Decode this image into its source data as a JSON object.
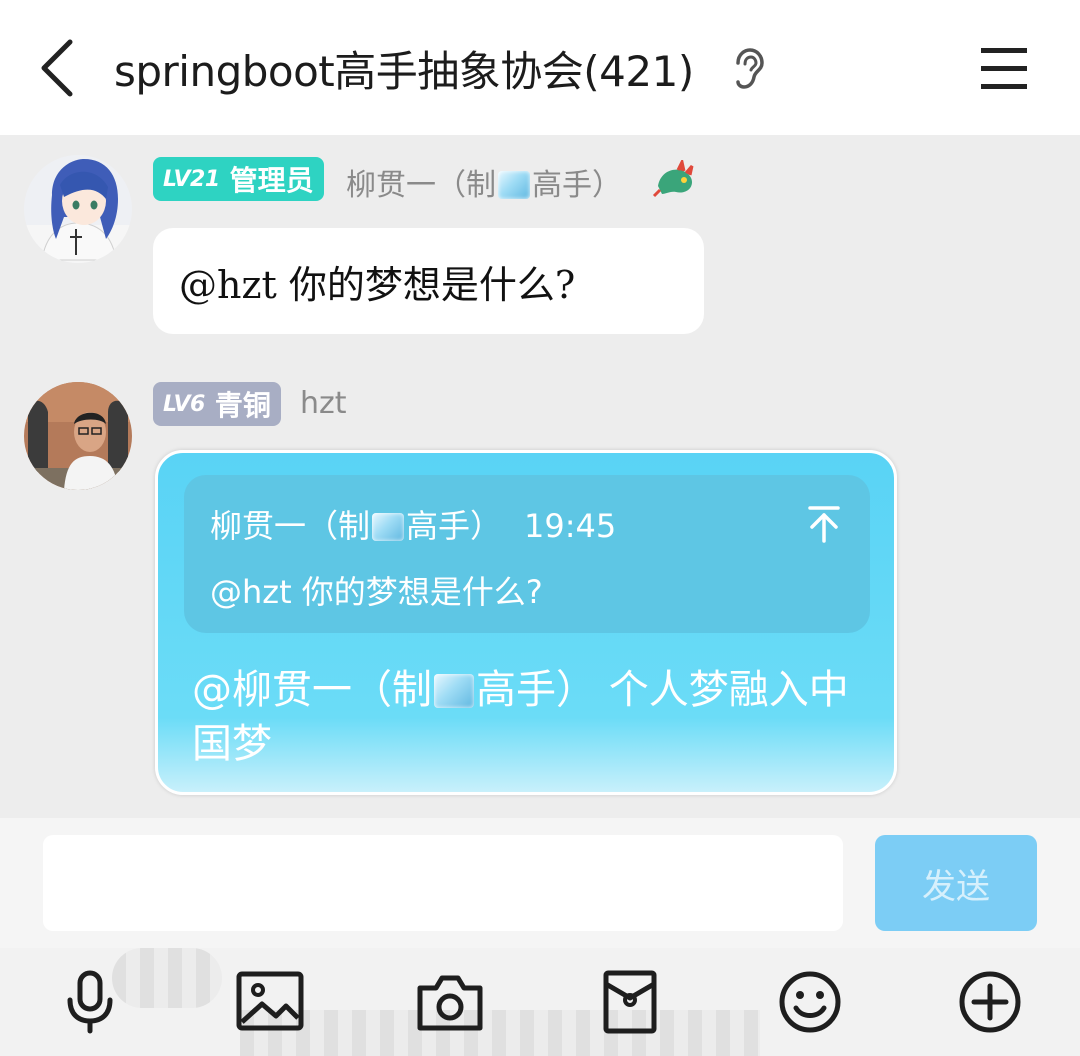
{
  "header": {
    "title": "springboot高手抽象协会(421)",
    "back_icon": "chevron-left-icon",
    "ear_icon": "ear-icon",
    "menu_icon": "hamburger-menu-icon"
  },
  "messages": [
    {
      "level": "LV21",
      "role": "管理员",
      "badge_color": "#2ed3c2",
      "sender_prefix": "柳贯一（制",
      "sender_suffix": "高手）",
      "text": "@hzt 你的梦想是什么?"
    },
    {
      "level": "LV6",
      "role": "青铜",
      "badge_color": "#a8aec4",
      "sender": "hzt",
      "quote": {
        "author_prefix": "柳贯一（制",
        "author_suffix": "高手）",
        "time": "19:45",
        "text": "@hzt 你的梦想是什么?",
        "jump_icon": "scroll-to-top-icon"
      },
      "reply_prefix": "@柳贯一（制",
      "reply_suffix": "高手） 个人梦融入中国梦"
    }
  ],
  "composer": {
    "input_value": "",
    "send_label": "发送"
  },
  "toolbar": {
    "items": [
      "microphone-icon",
      "image-icon",
      "camera-icon",
      "red-packet-icon",
      "emoji-icon",
      "plus-icon"
    ]
  },
  "colors": {
    "accent_bubble": "#5fd4f5",
    "send_button": "#7ccdf5"
  }
}
